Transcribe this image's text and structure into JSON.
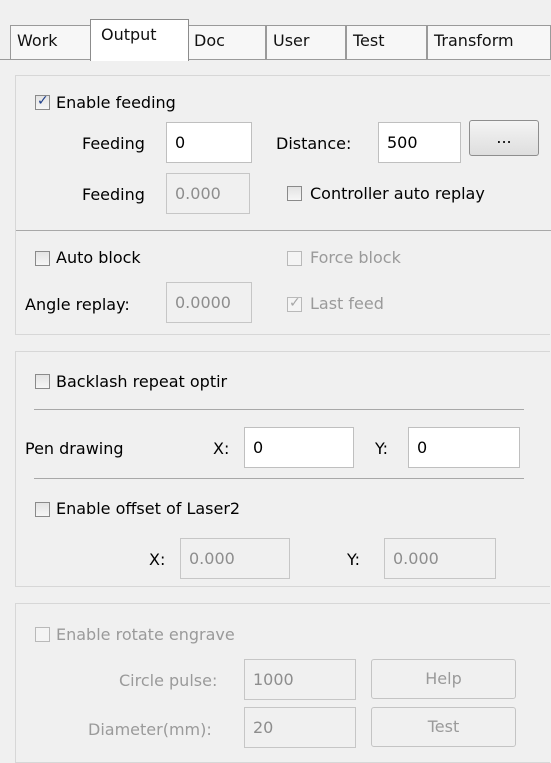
{
  "tabs": [
    {
      "label": "Work"
    },
    {
      "label": "Output"
    },
    {
      "label": "Doc"
    },
    {
      "label": "User"
    },
    {
      "label": "Test"
    },
    {
      "label": "Transform"
    }
  ],
  "active_tab": "Output",
  "feeding": {
    "enable_label": "Enable feeding",
    "enable_checked": true,
    "feeding_label": "Feeding",
    "feeding_value": "0",
    "distance_label": "Distance:",
    "distance_value": "500",
    "browse_label": "...",
    "feeding2_label": "Feeding",
    "feeding2_value": "0.000",
    "controller_auto_replay_label": "Controller auto replay",
    "controller_auto_replay_checked": false,
    "auto_block_label": "Auto block",
    "auto_block_checked": false,
    "force_block_label": "Force block",
    "force_block_checked": false,
    "angle_replay_label": "Angle replay:",
    "angle_replay_value": "0.0000",
    "last_feed_label": "Last feed",
    "last_feed_checked": true
  },
  "backlash": {
    "repeat_label": "Backlash repeat optir",
    "repeat_checked": false,
    "pen_drawing_label": "Pen drawing",
    "x_label": "X:",
    "x_value": "0",
    "y_label": "Y:",
    "y_value": "0",
    "laser2_label": "Enable offset of Laser2",
    "laser2_checked": false,
    "laser2_x_label": "X:",
    "laser2_x_value": "0.000",
    "laser2_y_label": "Y:",
    "laser2_y_value": "0.000"
  },
  "rotate": {
    "enable_label": "Enable rotate engrave",
    "enable_checked": false,
    "circle_pulse_label": "Circle pulse:",
    "circle_pulse_value": "1000",
    "help_label": "Help",
    "diameter_label": "Diameter(mm):",
    "diameter_value": "20",
    "test_label": "Test"
  }
}
